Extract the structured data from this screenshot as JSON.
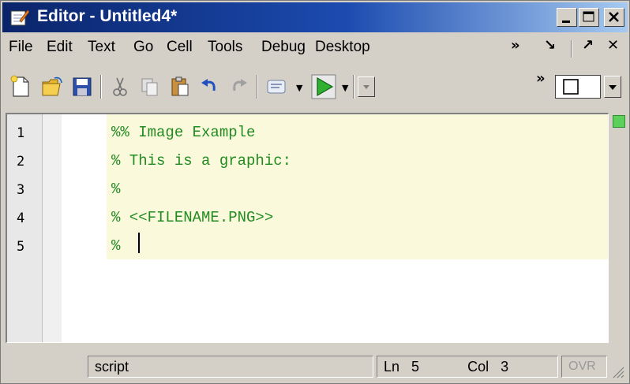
{
  "window": {
    "title": "Editor - Untitled4*"
  },
  "menu": {
    "items": [
      "File",
      "Edit",
      "Text",
      "Go",
      "Cell",
      "Tools",
      "Debug",
      "Desktop"
    ],
    "overflow_glyph": "»",
    "dock_glyph": "↘",
    "undock_glyph": "↗",
    "close_glyph": "✕"
  },
  "toolbar": {
    "icons": [
      "new-file-icon",
      "open-folder-icon",
      "save-icon",
      "cut-icon",
      "copy-icon",
      "paste-icon",
      "undo-icon",
      "redo-icon",
      "comment-icon",
      "run-icon"
    ],
    "overflow_glyph": "»"
  },
  "editor": {
    "line_numbers": [
      "1",
      "2",
      "3",
      "4",
      "5"
    ],
    "lines": [
      "%% Image Example",
      "% This is a graphic:",
      "%",
      "% <<FILENAME.PNG>>",
      "% "
    ],
    "cursor_line": 5
  },
  "status": {
    "mode": "script",
    "ln_label": "Ln",
    "ln_value": "5",
    "col_label": "Col",
    "col_value": "3",
    "ovr": "OVR"
  },
  "colors": {
    "title_bar": "#0a246a",
    "code_green": "#228b22",
    "cell_background": "#fbf9dc"
  }
}
